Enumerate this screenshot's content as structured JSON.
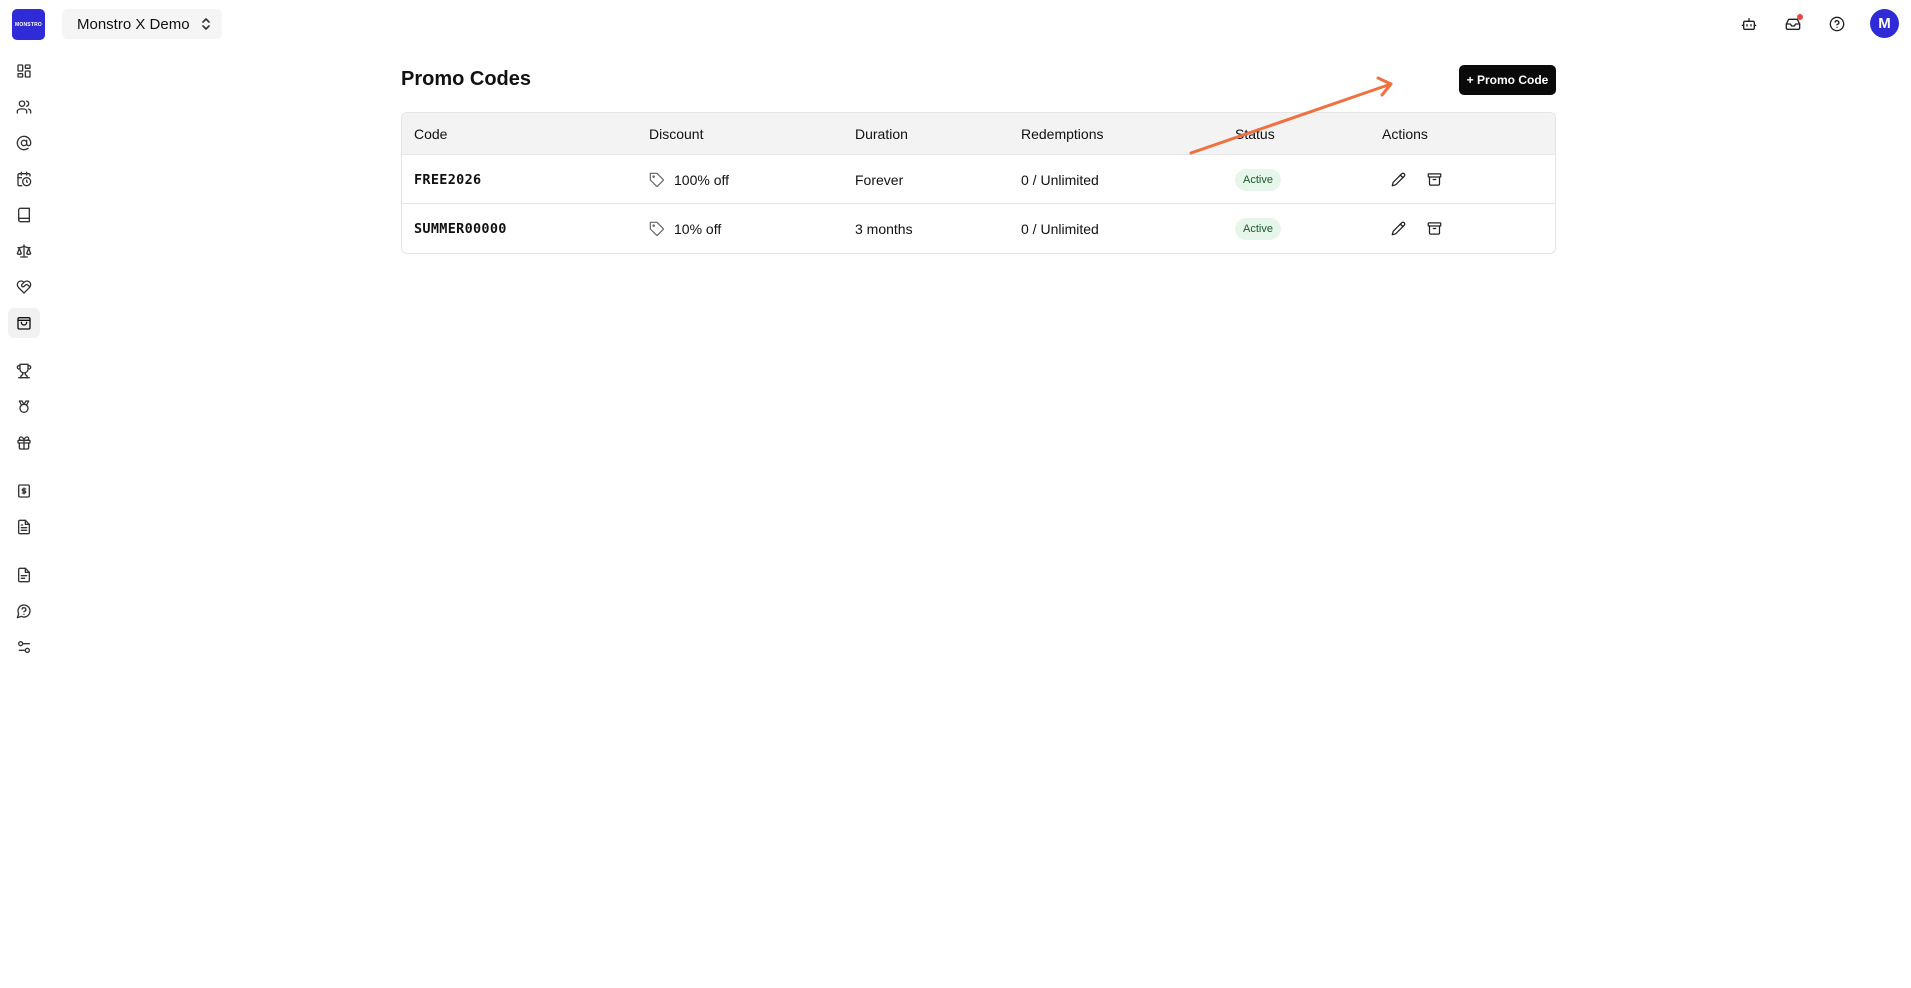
{
  "app": {
    "logo_text": "MONSTRO",
    "workspace_name": "Monstro X Demo",
    "avatar_initial": "M",
    "accent_color": "#2f2bd6"
  },
  "topbar": {
    "icons": [
      "bot-icon",
      "inbox-icon",
      "help-circle-icon"
    ]
  },
  "sidebar": {
    "items": [
      {
        "icon": "dashboard-icon"
      },
      {
        "icon": "users-icon"
      },
      {
        "icon": "at-sign-icon"
      },
      {
        "icon": "calendar-clock-icon"
      },
      {
        "icon": "book-icon"
      },
      {
        "icon": "scale-icon"
      },
      {
        "icon": "heart-handshake-icon"
      },
      {
        "icon": "shopping-bag-icon",
        "active": true
      },
      {
        "icon": "trophy-icon"
      },
      {
        "icon": "award-icon"
      },
      {
        "icon": "gift-icon"
      },
      {
        "icon": "dollar-receipt-icon"
      },
      {
        "icon": "document-list-icon"
      },
      {
        "icon": "document-icon"
      },
      {
        "icon": "help-circle-icon"
      },
      {
        "icon": "settings-sliders-icon"
      }
    ]
  },
  "main": {
    "title": "Promo Codes",
    "add_button_label": "+ Promo Code",
    "table": {
      "headers": [
        "Code",
        "Discount",
        "Duration",
        "Redemptions",
        "Status",
        "Actions"
      ],
      "rows": [
        {
          "code": "FREE2026",
          "discount": "100% off",
          "duration": "Forever",
          "redemptions": "0 / Unlimited",
          "status": "Active"
        },
        {
          "code": "SUMMER00000",
          "discount": "10% off",
          "duration": "3 months",
          "redemptions": "0 / Unlimited",
          "status": "Active"
        }
      ]
    }
  },
  "annotation": {
    "arrow_color": "#f07040"
  }
}
